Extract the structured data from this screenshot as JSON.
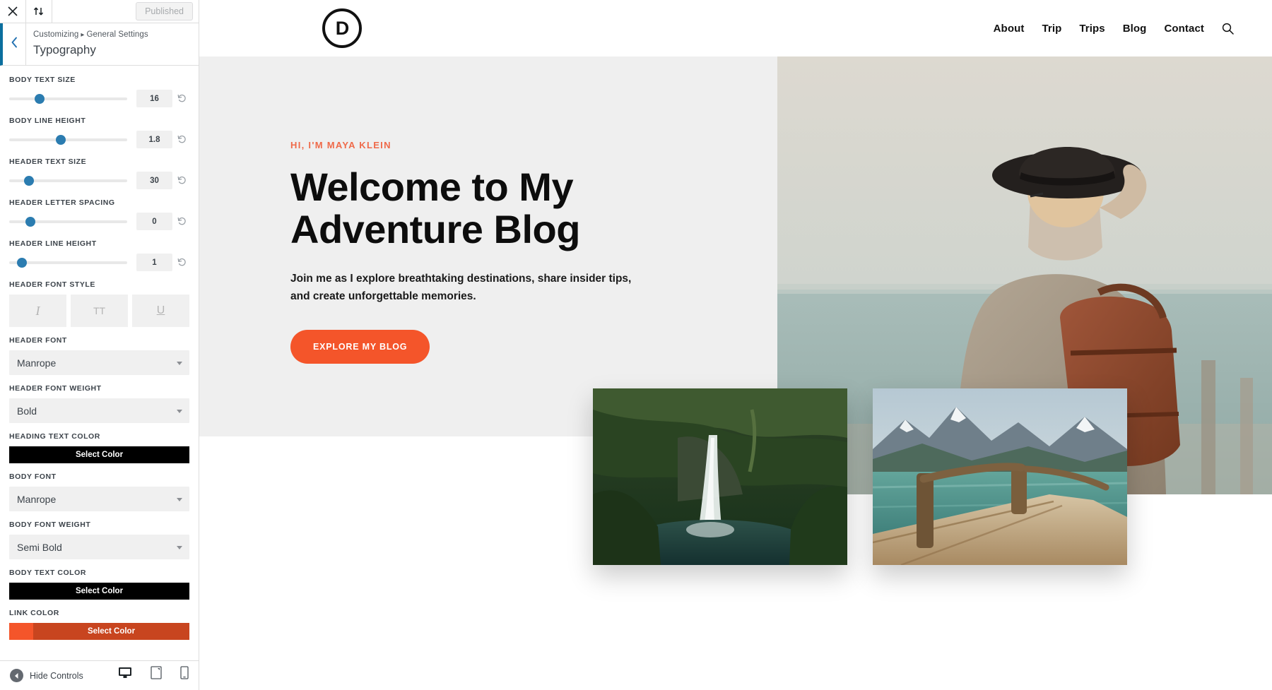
{
  "customizer": {
    "topbar": {
      "close_icon": "close-icon",
      "devices_toggle_icon": "collapse-expand-icon",
      "published_label": "Published"
    },
    "header": {
      "back_icon": "chevron-left-icon",
      "breadcrumb_root": "Customizing",
      "breadcrumb_separator": "▸",
      "breadcrumb_parent": "General Settings",
      "panel_title": "Typography"
    },
    "controls": [
      {
        "type": "slider",
        "label": "Body Text Size",
        "value": "16",
        "knob_pct": 26,
        "reset_icon": "reset-icon"
      },
      {
        "type": "slider",
        "label": "Body Line Height",
        "value": "1.8",
        "knob_pct": 44,
        "reset_icon": "reset-icon"
      },
      {
        "type": "slider",
        "label": "Header Text Size",
        "value": "30",
        "knob_pct": 17,
        "reset_icon": "reset-icon"
      },
      {
        "type": "slider",
        "label": "Header Letter Spacing",
        "value": "0",
        "knob_pct": 18,
        "reset_icon": "reset-icon"
      },
      {
        "type": "slider",
        "label": "Header Line Height",
        "value": "1",
        "knob_pct": 11,
        "reset_icon": "reset-icon"
      }
    ],
    "font_style": {
      "label": "Header Font Style",
      "buttons": [
        {
          "name": "italic",
          "glyph": "I"
        },
        {
          "name": "uppercase",
          "glyph": "TT"
        },
        {
          "name": "underline",
          "glyph": "U"
        }
      ]
    },
    "header_font": {
      "label": "Header Font",
      "value": "Manrope"
    },
    "header_font_weight": {
      "label": "Header Font Weight",
      "value": "Bold"
    },
    "heading_text_color": {
      "label": "Heading Text Color",
      "button": "Select Color",
      "color": "#000000",
      "has_swatch": false
    },
    "body_font": {
      "label": "Body Font",
      "value": "Manrope"
    },
    "body_font_weight": {
      "label": "Body Font Weight",
      "value": "Semi Bold"
    },
    "body_text_color": {
      "label": "Body Text Color",
      "button": "Select Color",
      "color": "#000000",
      "has_swatch": false
    },
    "link_color": {
      "label": "Link Color",
      "button": "Select Color",
      "color": "#c8451f",
      "swatch_color": "#f4552a",
      "has_swatch": true
    },
    "bottom": {
      "hide_controls_label": "Hide Controls",
      "hide_controls_icon": "arrow-left-circle-icon",
      "devices": [
        {
          "name": "desktop",
          "icon": "desktop-icon",
          "active": true
        },
        {
          "name": "tablet",
          "icon": "tablet-icon",
          "active": false
        },
        {
          "name": "mobile",
          "icon": "mobile-icon",
          "active": false
        }
      ]
    }
  },
  "preview": {
    "logo": {
      "name": "divi-logo",
      "letter": "D"
    },
    "nav": [
      {
        "label": "About"
      },
      {
        "label": "Trip"
      },
      {
        "label": "Trips"
      },
      {
        "label": "Blog"
      },
      {
        "label": "Contact"
      }
    ],
    "search_icon": "search-icon",
    "hero": {
      "eyebrow": "HI, I'M MAYA KLEIN",
      "title": "Welcome to My Adventure Blog",
      "subtitle": "Join me as I explore breathtaking destinations, share insider tips, and create unforgettable memories.",
      "cta": "EXPLORE MY BLOG",
      "accent_color": "#f4552a",
      "eyebrow_color": "#ef6a4a",
      "background_color": "#efefef",
      "photo_alt": "woman-with-hat-and-backpack-by-the-sea"
    },
    "cards": [
      {
        "alt": "waterfall-in-green-forest"
      },
      {
        "alt": "wooden-pier-on-mountain-lake"
      }
    ]
  }
}
